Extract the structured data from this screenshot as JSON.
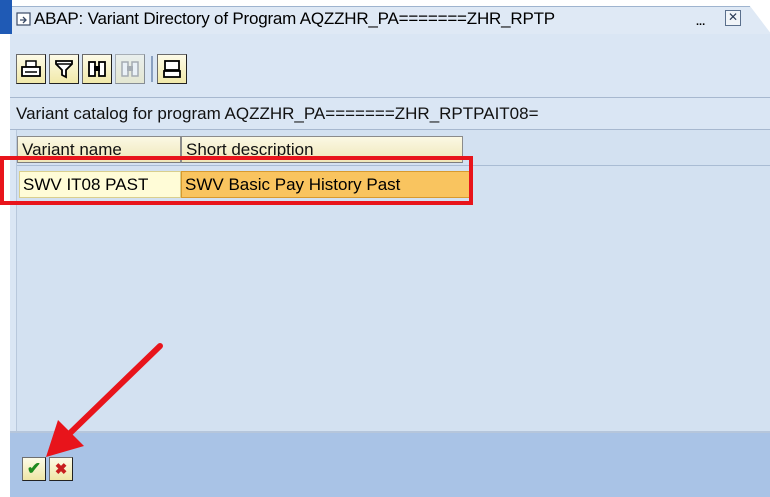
{
  "window": {
    "title": "ABAP: Variant Directory of Program AQZZHR_PA=======ZHR_RPTP",
    "title_ellipsis": "...",
    "close_glyph": "✕"
  },
  "toolbar": {
    "buttons": [
      {
        "icon": "print-icon",
        "enabled": true
      },
      {
        "icon": "filter-icon",
        "enabled": true
      },
      {
        "icon": "find-icon",
        "enabled": true
      },
      {
        "icon": "find-next-icon",
        "enabled": false
      },
      {
        "icon": "local-file-icon",
        "enabled": true
      }
    ]
  },
  "catalog": {
    "text": "Variant catalog for program AQZZHR_PA=======ZHR_RPTPAIT08="
  },
  "table": {
    "columns": [
      "Variant name",
      "Short description"
    ],
    "rows": [
      {
        "variant_name": "SWV IT08 PAST",
        "short_description": "SWV Basic Pay History Past"
      }
    ]
  },
  "footer": {
    "confirm_glyph": "✔",
    "cancel_glyph": "✖"
  },
  "colors": {
    "accent": "#1f5ab5",
    "panel": "#dae6f4",
    "footer": "#a9c3e6",
    "selected_cell": "#f9c45f",
    "annotation_red": "#e8141b"
  }
}
